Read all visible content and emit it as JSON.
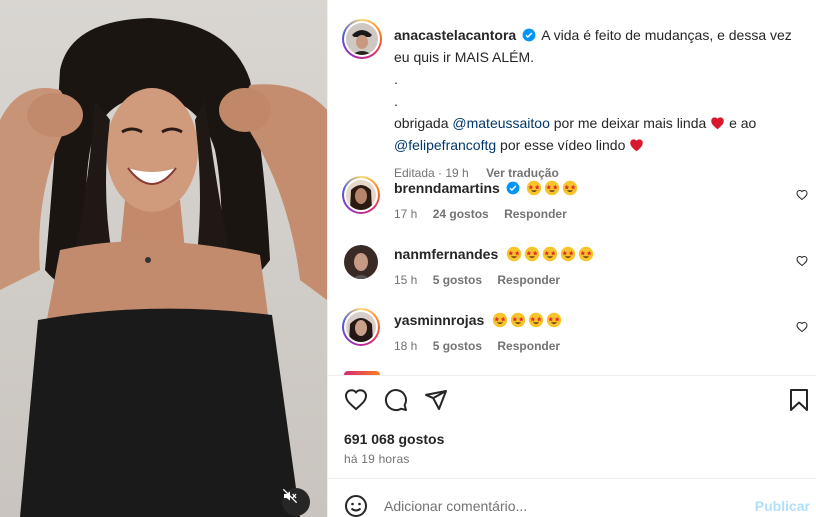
{
  "post": {
    "author": "anacastelacantora",
    "caption_line1": "A vida é feito de mudanças, e dessa vez eu quis ir MAIS ALÉM.",
    "dot1": ".",
    "dot2": ".",
    "thanks_prefix": "obrigada",
    "mention1": "@mateussaitoo",
    "thanks_mid": "por me deixar mais linda",
    "thanks_and": "e ao",
    "mention2": "@felipefrancoftg",
    "thanks_end": "por esse vídeo lindo",
    "edited": "Editada",
    "edited_time": "19 h",
    "translate": "Ver tradução"
  },
  "comments": [
    {
      "user": "brenndamartins",
      "verified": true,
      "emojis": 3,
      "time": "17 h",
      "likes": "24 gostos",
      "reply": "Responder"
    },
    {
      "user": "nanmfernandes",
      "verified": false,
      "emojis": 5,
      "time": "15 h",
      "likes": "5 gostos",
      "reply": "Responder"
    },
    {
      "user": "yasminnrojas",
      "verified": false,
      "emojis": 4,
      "time": "18 h",
      "likes": "5 gostos",
      "reply": "Responder"
    }
  ],
  "stats": {
    "likes": "691 068 gostos",
    "posted": "há 19 horas"
  },
  "composer": {
    "placeholder": "Adicionar comentário...",
    "publish": "Publicar"
  },
  "icons": {
    "like": "heart-icon",
    "comment": "comment-icon",
    "share": "share-icon",
    "save": "bookmark-icon",
    "emoji": "emoji-icon",
    "mute": "muted-speaker-icon"
  },
  "colors": {
    "verified": "#0095f6",
    "mention": "#00376b",
    "publish_disabled": "#b2dffc",
    "heart_red": "#e0245e"
  }
}
